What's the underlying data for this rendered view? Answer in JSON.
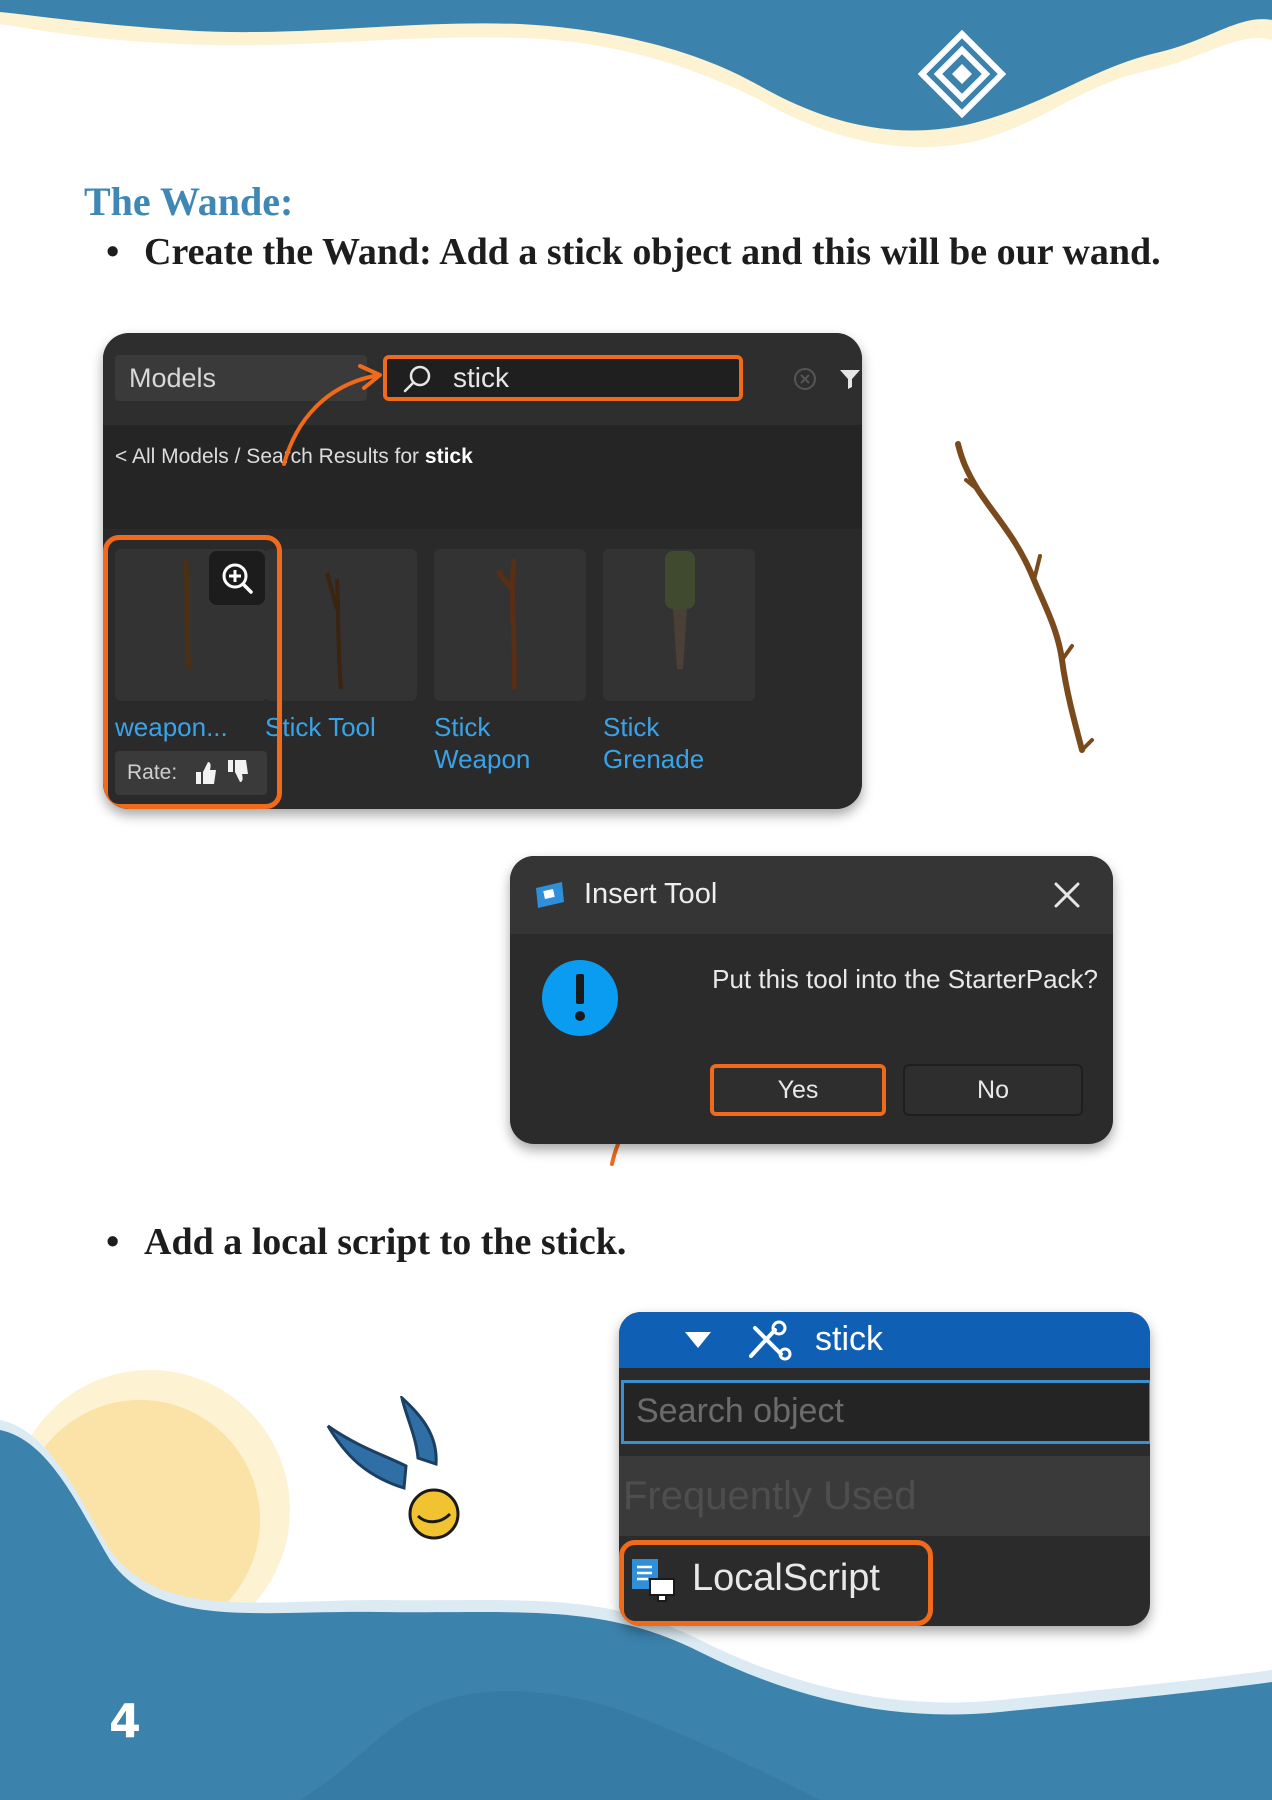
{
  "section_title": "The Wande:",
  "bullets": [
    {
      "marker": "•",
      "text": "Create the Wand: Add a stick object and this will be our wand."
    },
    {
      "marker": "•",
      "text": "Add a local script to the stick."
    }
  ],
  "toolbox": {
    "category": "Models",
    "search_value": "stick",
    "breadcrumb_prefix": "< All Models / Search Results for ",
    "breadcrumb_query": "stick",
    "results": [
      {
        "name": "weapon..."
      },
      {
        "name": "Stick Tool"
      },
      {
        "name": "Stick Weapon"
      },
      {
        "name": "Stick Grenade"
      }
    ],
    "rate_label": "Rate:"
  },
  "insert_dialog": {
    "title": "Insert Tool",
    "message": "Put this tool into the StarterPack?",
    "yes_label": "Yes",
    "no_label": "No"
  },
  "explorer": {
    "object_name": "stick",
    "search_placeholder": "Search object",
    "section_label": "Frequently Used",
    "item_label": "LocalScript"
  },
  "page_number": "4",
  "colors": {
    "accent_orange": "#f06a1b",
    "heading_blue": "#3f87b5",
    "wave_blue": "#3b82ad",
    "cream": "#fdf2d2",
    "sun_yellow": "#fbe3a8"
  },
  "icons": [
    "search-icon",
    "clear-icon",
    "filter-icon",
    "zoom-in-icon",
    "thumbs-up-icon",
    "thumbs-down-icon",
    "studio-icon",
    "close-icon",
    "alert-icon",
    "caret-down-icon",
    "tool-icon",
    "local-script-icon",
    "logo-icon",
    "stick-image",
    "golden-snitch-image"
  ]
}
